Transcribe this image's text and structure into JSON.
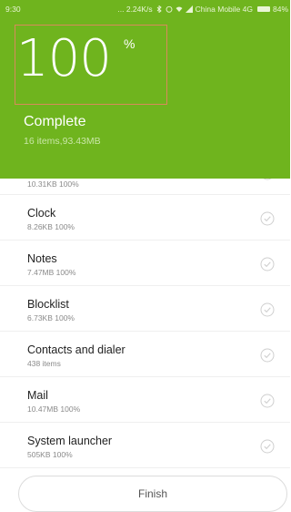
{
  "status_bar": {
    "time": "9:30",
    "speed": "... 2.24K/s",
    "carrier": "China Mobile 4G",
    "battery": "84%"
  },
  "progress": {
    "value": "100",
    "unit": "%",
    "title": "Complete",
    "subtitle": "16 items,93.43MB"
  },
  "items": [
    {
      "name": "",
      "detail": "10.31KB 100%"
    },
    {
      "name": "Clock",
      "detail": "8.26KB 100%"
    },
    {
      "name": "Notes",
      "detail": "7.47MB 100%"
    },
    {
      "name": "Blocklist",
      "detail": "6.73KB 100%"
    },
    {
      "name": "Contacts and dialer",
      "detail": "438 items"
    },
    {
      "name": "Mail",
      "detail": "10.47MB 100%"
    },
    {
      "name": "System launcher",
      "detail": "505KB 100%"
    }
  ],
  "footer": {
    "finish_label": "Finish"
  },
  "colors": {
    "header_bg": "#6fb41e",
    "check": "#cfcfcf"
  },
  "icons": {
    "row_status": "check-circle-icon"
  }
}
